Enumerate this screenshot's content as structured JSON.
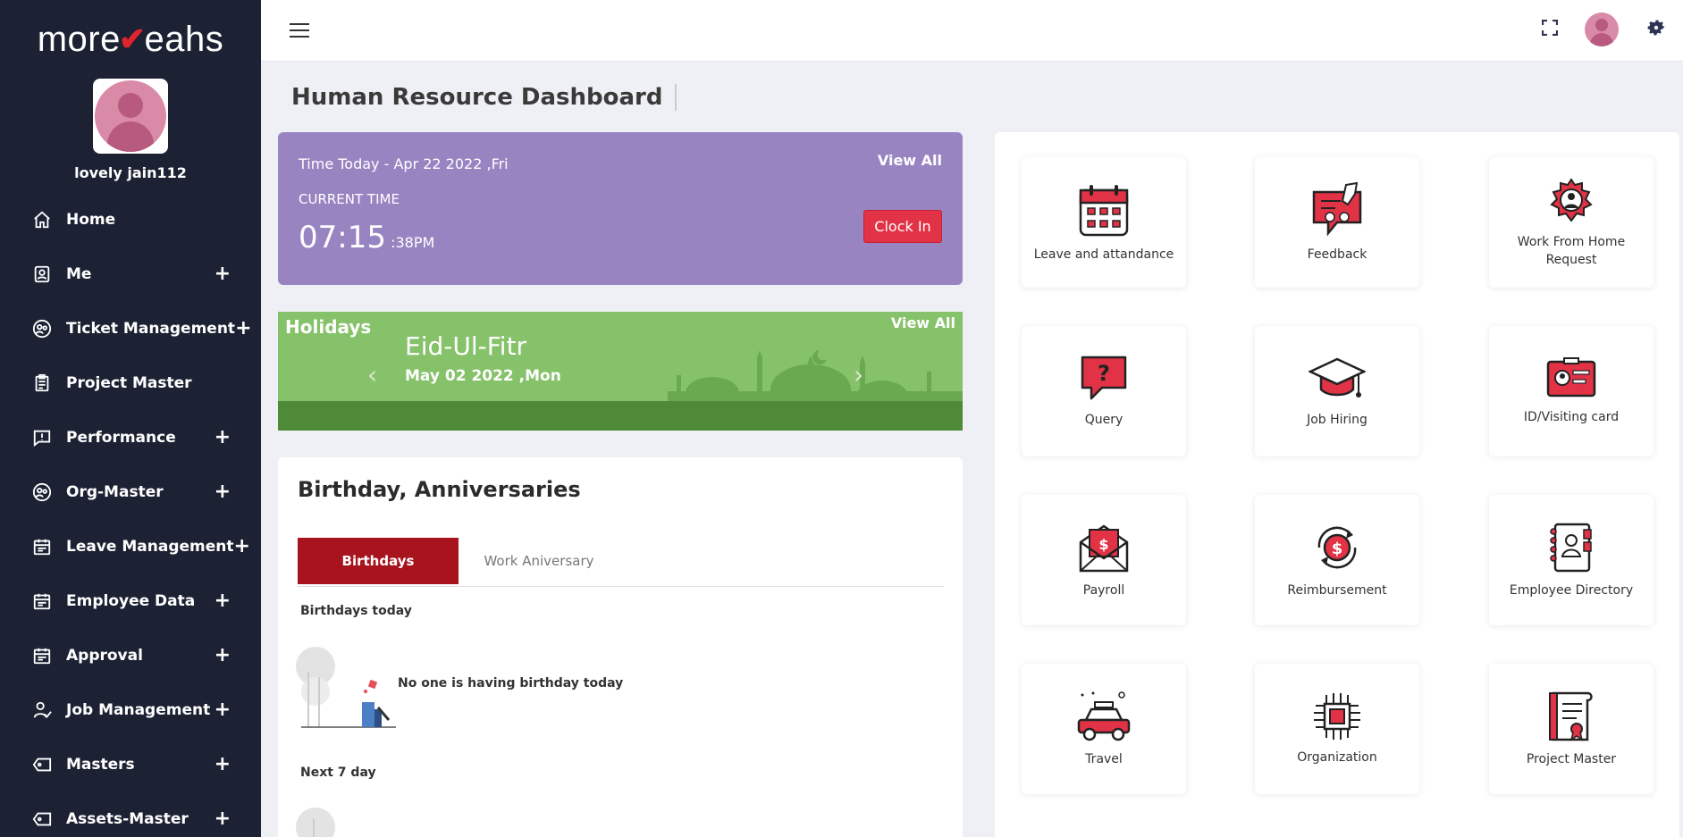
{
  "brand": {
    "logo_left": "more",
    "logo_check": "✔",
    "logo_right": "eahs"
  },
  "user": {
    "name": "lovely jain112"
  },
  "sidebar": {
    "items": [
      {
        "label": "Home",
        "icon": "home-icon",
        "expandable": false
      },
      {
        "label": "Me",
        "icon": "id-badge-icon",
        "expandable": true
      },
      {
        "label": "Ticket Management",
        "icon": "people-circle-icon",
        "expandable": true
      },
      {
        "label": "Project Master",
        "icon": "clipboard-icon",
        "expandable": false
      },
      {
        "label": "Performance",
        "icon": "chat-alert-icon",
        "expandable": true
      },
      {
        "label": "Org-Master",
        "icon": "people-circle-icon",
        "expandable": true
      },
      {
        "label": "Leave Management",
        "icon": "calendar-icon",
        "expandable": true
      },
      {
        "label": "Employee Data",
        "icon": "calendar-icon",
        "expandable": true
      },
      {
        "label": "Approval",
        "icon": "calendar-icon",
        "expandable": true
      },
      {
        "label": "Job Management",
        "icon": "user-check-icon",
        "expandable": true
      },
      {
        "label": "Masters",
        "icon": "tag-icon",
        "expandable": true
      },
      {
        "label": "Assets-Master",
        "icon": "tag-icon",
        "expandable": true
      }
    ],
    "plus": "+"
  },
  "page": {
    "title": "Human Resource Dashboard"
  },
  "time_card": {
    "today": "Time Today - Apr 22 2022 ,Fri",
    "view_all": "View All",
    "current_label": "CURRENT TIME",
    "time_main": "07:15",
    "time_sub": " :38PM",
    "clock_in": "Clock In",
    "bg_color": "#9984c2",
    "button_color": "#e23246"
  },
  "holidays": {
    "title": "Holidays",
    "view_all": "View All",
    "name": "Eid-Ul-Fitr",
    "date": "May 02 2022 ,Mon",
    "prev": "‹",
    "next": "›"
  },
  "birthdays": {
    "title": "Birthday, Anniversaries",
    "tabs": [
      "Birthdays",
      "Work Aniversary"
    ],
    "today_label": "Birthdays today",
    "none_text": "No one is having birthday today",
    "next_label": "Next 7 day"
  },
  "tiles": [
    {
      "label": "Leave and attandance",
      "icon": "calendar-icon"
    },
    {
      "label": "Feedback",
      "icon": "feedback-icon"
    },
    {
      "label": "Work From Home Request",
      "icon": "work-from-home-icon"
    },
    {
      "label": "Query",
      "icon": "question-bubble-icon"
    },
    {
      "label": "Job Hiring",
      "icon": "graduation-cap-icon"
    },
    {
      "label": "ID/Visiting card",
      "icon": "id-card-icon"
    },
    {
      "label": "Payroll",
      "icon": "envelope-money-icon"
    },
    {
      "label": "Reimbursement",
      "icon": "dollar-cycle-icon"
    },
    {
      "label": "Employee Directory",
      "icon": "directory-book-icon"
    },
    {
      "label": "Travel",
      "icon": "car-icon"
    },
    {
      "label": "Organization",
      "icon": "chip-icon"
    },
    {
      "label": "Project Master",
      "icon": "certificate-icon"
    }
  ],
  "colors": {
    "sidebar_bg": "#1c2233",
    "accent_red": "#e0242e",
    "tab_active": "#a8141e",
    "holiday_green": "#86c26a"
  }
}
